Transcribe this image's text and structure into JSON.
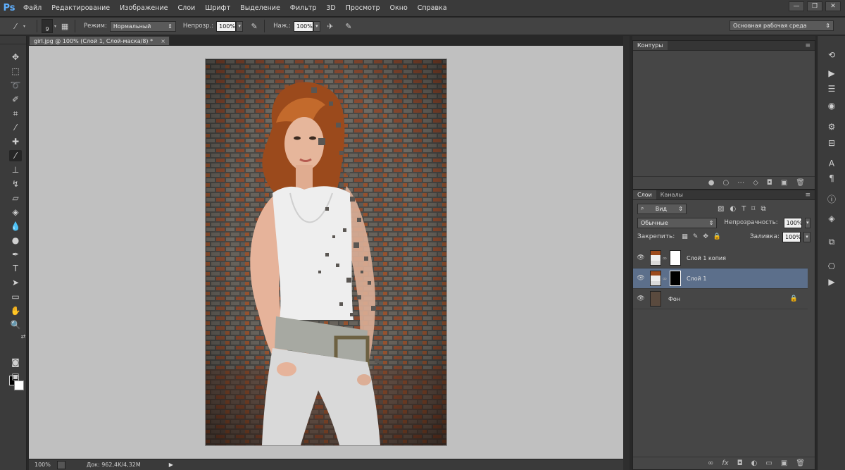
{
  "app": {
    "logo": "Ps"
  },
  "menu": [
    "Файл",
    "Редактирование",
    "Изображение",
    "Слои",
    "Шрифт",
    "Выделение",
    "Фильтр",
    "3D",
    "Просмотр",
    "Окно",
    "Справка"
  ],
  "window_controls": {
    "minimize": "—",
    "restore": "❐",
    "close": "✕"
  },
  "options": {
    "brush_size": "9",
    "mode_label": "Режим:",
    "mode_value": "Нормальный",
    "opacity_label": "Непрозр.:",
    "opacity_value": "100%",
    "flow_label": "Наж.:",
    "flow_value": "100%",
    "workspace": "Основная рабочая среда"
  },
  "document": {
    "tab_title": "girl.jpg @ 100% (Слой 1, Слой-маска/8) *",
    "zoom": "100%",
    "doc_info": "Док: 962,4K/4,32M"
  },
  "paths_panel": {
    "tab": "Контуры"
  },
  "layers_panel": {
    "tabs": [
      "Слои",
      "Каналы"
    ],
    "filter_kind": "Вид",
    "blend_mode": "Обычные",
    "opacity_label": "Непрозрачность:",
    "opacity_value": "100%",
    "lock_label": "Закрепить:",
    "fill_label": "Заливка:",
    "fill_value": "100%",
    "layers": [
      {
        "name": "Слой 1 копия",
        "selected": false
      },
      {
        "name": "Слой 1",
        "selected": true
      },
      {
        "name": "Фон",
        "selected": false
      }
    ]
  },
  "colors": {
    "accent": "#5fb0ff",
    "selected_layer": "#5c6f8b",
    "canvas_bg": "#c0c0c0",
    "foreground": "#000000",
    "background": "#ffffff"
  }
}
